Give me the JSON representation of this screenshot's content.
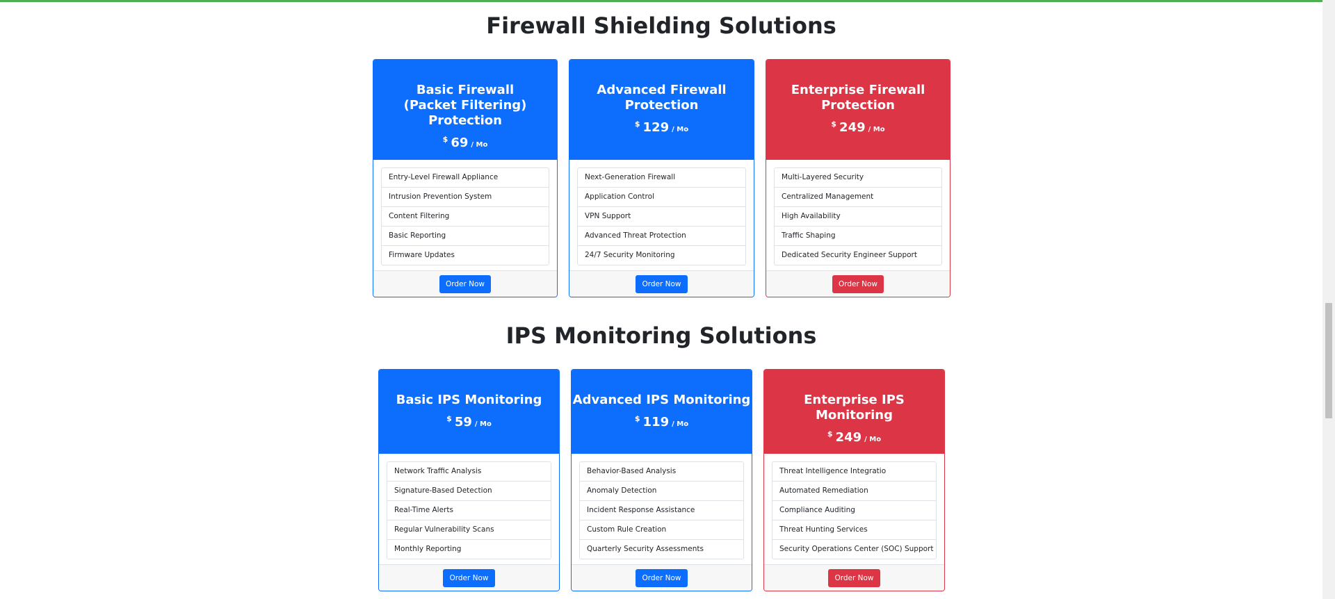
{
  "sections": [
    {
      "title": "Firewall Shielding Solutions",
      "plans": [
        {
          "name": "Basic Firewall (Packet Filtering) Protection",
          "currency": "$",
          "price": "69",
          "period": "/ Mo",
          "features": [
            "Entry-Level Firewall Appliance",
            "Intrusion Prevention System",
            "Content Filtering",
            "Basic Reporting",
            "Firmware Updates"
          ],
          "button": "Order Now"
        },
        {
          "name": "Advanced Firewall Protection",
          "currency": "$",
          "price": "129",
          "period": "/ Mo",
          "features": [
            "Next-Generation Firewall",
            "Application Control",
            "VPN Support",
            "Advanced Threat Protection",
            "24/7 Security Monitoring"
          ],
          "button": "Order Now"
        },
        {
          "name": "Enterprise Firewall Protection",
          "currency": "$",
          "price": "249",
          "period": "/ Mo",
          "features": [
            "Multi-Layered Security",
            "Centralized Management",
            "High Availability",
            "Traffic Shaping",
            "Dedicated Security Engineer Support"
          ],
          "button": "Order Now"
        }
      ]
    },
    {
      "title": "IPS Monitoring Solutions",
      "plans": [
        {
          "name": "Basic IPS Monitoring",
          "currency": "$",
          "price": "59",
          "period": "/ Mo",
          "features": [
            "Network Traffic Analysis",
            "Signature-Based Detection",
            "Real-Time Alerts",
            "Regular Vulnerability Scans",
            "Monthly Reporting"
          ],
          "button": "Order Now"
        },
        {
          "name": "Advanced IPS Monitoring",
          "currency": "$",
          "price": "119",
          "period": "/ Mo",
          "features": [
            "Behavior-Based Analysis",
            "Anomaly Detection",
            "Incident Response Assistance",
            "Custom Rule Creation",
            "Quarterly Security Assessments"
          ],
          "button": "Order Now"
        },
        {
          "name": "Enterprise IPS Monitoring",
          "currency": "$",
          "price": "249",
          "period": "/ Mo",
          "features": [
            "Threat Intelligence Integratio",
            "Automated Remediation",
            "Compliance Auditing",
            "Threat Hunting Services",
            "Security Operations Center (SOC) Support"
          ],
          "button": "Order Now"
        }
      ]
    }
  ],
  "colors": {
    "primary": "#0d6efd",
    "danger": "#dc3545",
    "top_accent": "#4caf50"
  }
}
